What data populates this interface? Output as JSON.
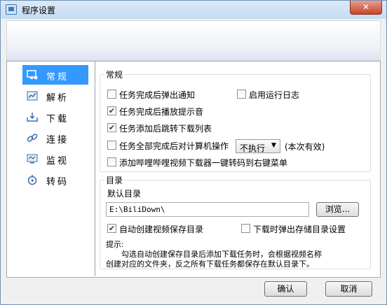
{
  "window": {
    "title": "程序设置",
    "close_label": "✕"
  },
  "sidebar": {
    "items": [
      {
        "label": "常规",
        "icon": "monitor-settings-icon"
      },
      {
        "label": "解析",
        "icon": "chart-icon"
      },
      {
        "label": "下载",
        "icon": "download-tray-icon"
      },
      {
        "label": "连接",
        "icon": "link-icon"
      },
      {
        "label": "监视",
        "icon": "monitor-icon"
      },
      {
        "label": "转码",
        "icon": "transcode-icon"
      }
    ],
    "active_index": 0
  },
  "general": {
    "legend": "常规",
    "notify_on_complete": {
      "label": "任务完成后弹出通知",
      "checked": false
    },
    "enable_log": {
      "label": "启用运行日志",
      "checked": false
    },
    "play_sound": {
      "label": "任务完成后播放提示音",
      "checked": true
    },
    "jump_to_list": {
      "label": "任务添加后跳转下载列表",
      "checked": true
    },
    "after_all_complete": {
      "label": "任务全部完成后对计算机操作",
      "checked": false
    },
    "action_select": {
      "value": "不执行"
    },
    "action_suffix": "(本次有效)",
    "context_menu": {
      "label": "添加哔哩哔哩视频下载器一键转码到右键菜单",
      "checked": false
    }
  },
  "directory": {
    "legend": "目录",
    "default_label": "默认目录",
    "path_value": "E:\\BiliDown\\",
    "browse_label": "浏览...",
    "auto_create": {
      "label": "自动创建视频保存目录",
      "checked": true
    },
    "popup_on_download": {
      "label": "下载时弹出存储目录设置",
      "checked": false
    },
    "hint_title": "提示:",
    "hint_line1": "勾选自动创建保存目录后添加下载任务时，会根据视频名称",
    "hint_line2": "创建对应的文件夹，反之所有下载任务都保存在默认目录下。"
  },
  "footer": {
    "ok_label": "确认",
    "cancel_label": "取消"
  },
  "colors": {
    "accent": "#3399ff",
    "titlebar": "#c6dcf2",
    "close": "#c7432a"
  }
}
